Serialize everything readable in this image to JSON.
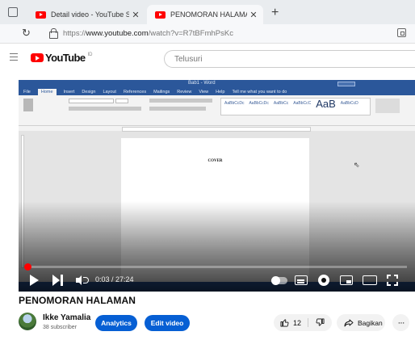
{
  "browser": {
    "tabs": [
      {
        "title": "Detail video - YouTube Studio",
        "active": false
      },
      {
        "title": "PENOMORAN HALAMAN - YouTu",
        "active": true
      }
    ],
    "url_prefix": "https://",
    "url_domain": "www.youtube.com",
    "url_path": "/watch?v=R7tBFmhPsKc"
  },
  "header": {
    "logo_text": "YouTube",
    "logo_region": "ID",
    "search_placeholder": "Telusuri"
  },
  "player": {
    "time_display": "0:03 / 27:24",
    "progress_fraction": 0.0018,
    "word_doc": {
      "ribbon_tabs": [
        "File",
        "Home",
        "Insert",
        "Design",
        "Layout",
        "References",
        "Mailings",
        "Review",
        "View",
        "Help",
        "Tell me what you want to do"
      ],
      "styles": [
        "AaBbCcDc",
        "AaBbCcDc",
        "AaBbCc",
        "AaBbCcC",
        "AaB",
        "AaBbCcD"
      ],
      "page_text": "COVER"
    }
  },
  "video": {
    "title": "PENOMORAN HALAMAN",
    "channel_name": "Ikke Yamalia",
    "subscribers": "38 subscriber",
    "analytics_label": "Analytics",
    "edit_label": "Edit video",
    "like_count": "12",
    "share_label": "Bagikan",
    "more_label": "···"
  },
  "colors": {
    "brand_red": "#ff0000",
    "studio_blue": "#065fd4",
    "word_blue": "#2b579a"
  },
  "icons": [
    "window-icon",
    "youtube-favicon",
    "close-icon",
    "plus-icon",
    "reload-icon",
    "lock-icon",
    "menu-icon",
    "play-icon",
    "next-icon",
    "volume-icon",
    "autoplay-icon",
    "captions-icon",
    "gear-icon",
    "miniplayer-icon",
    "theater-icon",
    "fullscreen-icon",
    "thumb-up-icon",
    "thumb-down-icon",
    "share-icon"
  ]
}
